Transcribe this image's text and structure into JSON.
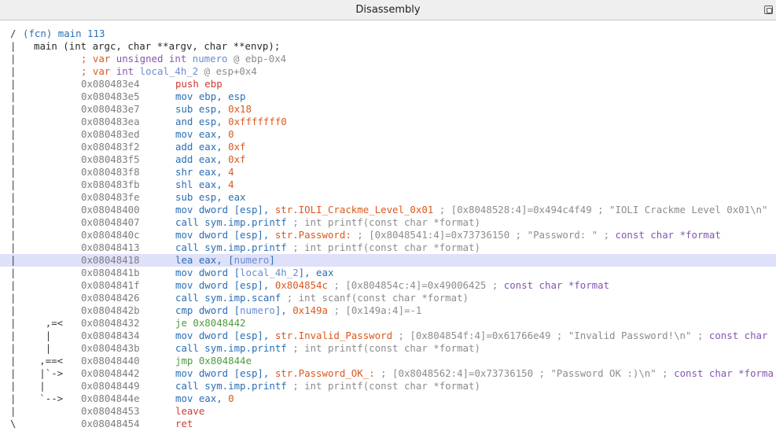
{
  "window": {
    "title": "Disassembly"
  },
  "header": {
    "indicator": "/",
    "fcn": "(fcn) main 113",
    "sig_bar": "|",
    "signature": "main (int argc, char **argv, char **envp);"
  },
  "vars": [
    {
      "bar": "|",
      "prefix": "; var ",
      "type": "unsigned int",
      "name": "numero",
      "loc": " @ ebp-0x4"
    },
    {
      "bar": "|",
      "prefix": "; var ",
      "type": "int",
      "name": "local_4h_2",
      "loc": " @ esp+0x4"
    }
  ],
  "lines": [
    {
      "flow": "|",
      "addr": "0x080483e4",
      "parts": [
        {
          "t": "push ebp",
          "c": "c-red"
        }
      ]
    },
    {
      "flow": "|",
      "addr": "0x080483e5",
      "parts": [
        {
          "t": "mov ebp, esp",
          "c": "c-blue"
        }
      ]
    },
    {
      "flow": "|",
      "addr": "0x080483e7",
      "parts": [
        {
          "t": "sub esp, ",
          "c": "c-blue"
        },
        {
          "t": "0x18",
          "c": "c-num"
        }
      ]
    },
    {
      "flow": "|",
      "addr": "0x080483ea",
      "parts": [
        {
          "t": "and esp, ",
          "c": "c-blue"
        },
        {
          "t": "0xfffffff0",
          "c": "c-num"
        }
      ]
    },
    {
      "flow": "|",
      "addr": "0x080483ed",
      "parts": [
        {
          "t": "mov eax, ",
          "c": "c-blue"
        },
        {
          "t": "0",
          "c": "c-num"
        }
      ]
    },
    {
      "flow": "|",
      "addr": "0x080483f2",
      "parts": [
        {
          "t": "add eax, ",
          "c": "c-blue"
        },
        {
          "t": "0xf",
          "c": "c-num"
        }
      ]
    },
    {
      "flow": "|",
      "addr": "0x080483f5",
      "parts": [
        {
          "t": "add eax, ",
          "c": "c-blue"
        },
        {
          "t": "0xf",
          "c": "c-num"
        }
      ]
    },
    {
      "flow": "|",
      "addr": "0x080483f8",
      "parts": [
        {
          "t": "shr eax, ",
          "c": "c-blue"
        },
        {
          "t": "4",
          "c": "c-num"
        }
      ]
    },
    {
      "flow": "|",
      "addr": "0x080483fb",
      "parts": [
        {
          "t": "shl eax, ",
          "c": "c-blue"
        },
        {
          "t": "4",
          "c": "c-num"
        }
      ]
    },
    {
      "flow": "|",
      "addr": "0x080483fe",
      "parts": [
        {
          "t": "sub esp, eax",
          "c": "c-blue"
        }
      ]
    },
    {
      "flow": "|",
      "addr": "0x08048400",
      "parts": [
        {
          "t": "mov dword [esp], ",
          "c": "c-blue"
        },
        {
          "t": "str.IOLI_Crackme_Level_0x01",
          "c": "c-num"
        },
        {
          "t": " ; [0x8048528:4]=0x494c4f49 ; \"IOLI Crackme Level 0x01\\n\"",
          "c": "c-cmt"
        }
      ]
    },
    {
      "flow": "|",
      "addr": "0x08048407",
      "parts": [
        {
          "t": "call sym.imp.printf",
          "c": "c-blue"
        },
        {
          "t": " ; int printf(const char *format)",
          "c": "c-cmt"
        }
      ]
    },
    {
      "flow": "|",
      "addr": "0x0804840c",
      "parts": [
        {
          "t": "mov dword [esp], ",
          "c": "c-blue"
        },
        {
          "t": "str.Password:",
          "c": "c-num"
        },
        {
          "t": " ; [0x8048541:4]=0x73736150 ; \"Password: \" ; ",
          "c": "c-cmt"
        },
        {
          "t": "const char *format",
          "c": "c-pur"
        }
      ]
    },
    {
      "flow": "|",
      "addr": "0x08048413",
      "parts": [
        {
          "t": "call sym.imp.printf",
          "c": "c-blue"
        },
        {
          "t": " ; int printf(const char *format)",
          "c": "c-cmt"
        }
      ]
    },
    {
      "flow": "|",
      "addr": "0x08048418",
      "hl": true,
      "parts": [
        {
          "t": "lea eax, [",
          "c": "c-blue"
        },
        {
          "t": "numero",
          "c": "c-var"
        },
        {
          "t": "]",
          "c": "c-blue"
        }
      ]
    },
    {
      "flow": "|",
      "addr": "0x0804841b",
      "parts": [
        {
          "t": "mov dword [",
          "c": "c-blue"
        },
        {
          "t": "local_4h_2",
          "c": "c-var"
        },
        {
          "t": "], eax",
          "c": "c-blue"
        }
      ]
    },
    {
      "flow": "|",
      "addr": "0x0804841f",
      "parts": [
        {
          "t": "mov dword [esp], ",
          "c": "c-blue"
        },
        {
          "t": "0x804854c",
          "c": "c-num"
        },
        {
          "t": " ; [0x804854c:4]=0x49006425 ; ",
          "c": "c-cmt"
        },
        {
          "t": "const char *format",
          "c": "c-pur"
        }
      ]
    },
    {
      "flow": "|",
      "addr": "0x08048426",
      "parts": [
        {
          "t": "call sym.imp.scanf",
          "c": "c-blue"
        },
        {
          "t": " ; int scanf(const char *format)",
          "c": "c-cmt"
        }
      ]
    },
    {
      "flow": "|",
      "addr": "0x0804842b",
      "parts": [
        {
          "t": "cmp dword [",
          "c": "c-blue"
        },
        {
          "t": "numero",
          "c": "c-var"
        },
        {
          "t": "], ",
          "c": "c-blue"
        },
        {
          "t": "0x149a",
          "c": "c-num"
        },
        {
          "t": " ; [0x149a:4]=-1",
          "c": "c-cmt"
        }
      ]
    },
    {
      "flow": "|     ,=<",
      "addr": "0x08048432",
      "parts": [
        {
          "t": "je 0x8048442",
          "c": "c-grn"
        }
      ]
    },
    {
      "flow": "|     |",
      "addr": "0x08048434",
      "parts": [
        {
          "t": "mov dword [esp], ",
          "c": "c-blue"
        },
        {
          "t": "str.Invalid_Password",
          "c": "c-num"
        },
        {
          "t": " ; [0x804854f:4]=0x61766e49 ; \"Invalid Password!\\n\" ; ",
          "c": "c-cmt"
        },
        {
          "t": "const char",
          "c": "c-pur"
        }
      ]
    },
    {
      "flow": "|     |",
      "addr": "0x0804843b",
      "parts": [
        {
          "t": "call sym.imp.printf",
          "c": "c-blue"
        },
        {
          "t": " ; int printf(const char *format)",
          "c": "c-cmt"
        }
      ]
    },
    {
      "flow": "|    ,==<",
      "addr": "0x08048440",
      "parts": [
        {
          "t": "jmp 0x804844e",
          "c": "c-grn"
        }
      ]
    },
    {
      "flow": "|    |`->",
      "addr": "0x08048442",
      "parts": [
        {
          "t": "mov dword [esp], ",
          "c": "c-blue"
        },
        {
          "t": "str.Password_OK_:",
          "c": "c-num"
        },
        {
          "t": " ; [0x8048562:4]=0x73736150 ; \"Password OK :)\\n\" ; ",
          "c": "c-cmt"
        },
        {
          "t": "const char *forma",
          "c": "c-pur"
        }
      ]
    },
    {
      "flow": "|    |",
      "addr": "0x08048449",
      "parts": [
        {
          "t": "call sym.imp.printf",
          "c": "c-blue"
        },
        {
          "t": " ; int printf(const char *format)",
          "c": "c-cmt"
        }
      ]
    },
    {
      "flow": "|    `-->",
      "addr": "0x0804844e",
      "parts": [
        {
          "t": "mov eax, ",
          "c": "c-blue"
        },
        {
          "t": "0",
          "c": "c-num"
        }
      ]
    },
    {
      "flow": "|",
      "addr": "0x08048453",
      "parts": [
        {
          "t": "leave",
          "c": "c-red"
        }
      ]
    },
    {
      "flow": "\\",
      "addr": "0x08048454",
      "parts": [
        {
          "t": "ret",
          "c": "c-red"
        }
      ]
    }
  ]
}
